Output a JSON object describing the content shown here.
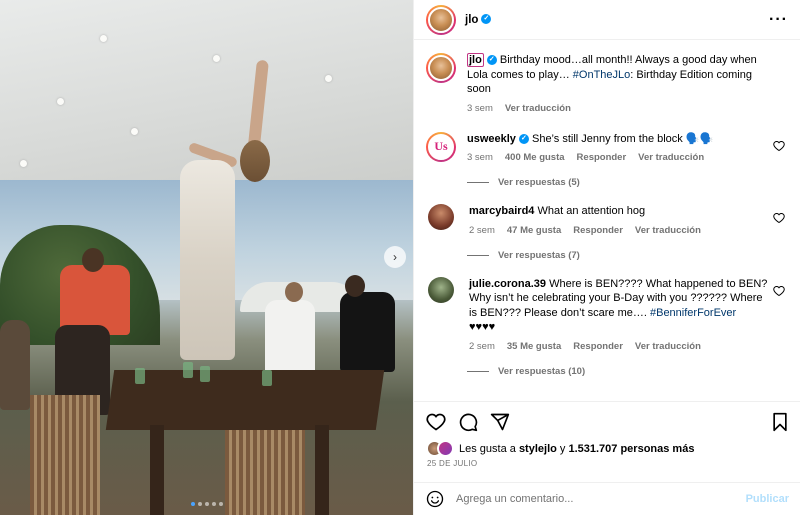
{
  "post": {
    "username": "jlo",
    "photo_alt": "Mujer bailando sobre una mesa en una fiesta de cumpleaños",
    "carousel_pages": 5,
    "carousel_active": 1
  },
  "caption": {
    "username": "jlo",
    "text_before": "Birthday mood…all month!! Always a good day when Lola comes to play… ",
    "hashtag": "#OnTheJLo",
    "text_after": ": Birthday Edition coming soon",
    "time": "3 sem",
    "translate": "Ver traducción"
  },
  "comments": [
    {
      "username": "usweekly",
      "verified": true,
      "text": "She’s still Jenny from the block 🗣️🗣️",
      "time": "3 sem",
      "likes": "400 Me gusta",
      "reply": "Responder",
      "translate": "Ver traducción",
      "replies": "Ver respuestas (5)"
    },
    {
      "username": "marcybaird4",
      "verified": false,
      "text": "What an attention hog",
      "time": "2 sem",
      "likes": "47 Me gusta",
      "reply": "Responder",
      "translate": "Ver traducción",
      "replies": "Ver respuestas (7)"
    },
    {
      "username": "julie.corona.39",
      "verified": false,
      "text": "Where is BEN???? What happened to BEN? Why isn’t he celebrating your B-Day with you ?????? Where is BEN??? Please don’t scare me…. ",
      "hashtag": "#BenniferForEver",
      "text_after": "♥♥♥♥",
      "time": "2 sem",
      "likes": "35 Me gusta",
      "reply": "Responder",
      "translate": "Ver traducción",
      "replies": "Ver respuestas (10)"
    }
  ],
  "likes": {
    "prefix": "Les gusta a ",
    "user": "stylejlo",
    "middle": " y ",
    "count": "1.531.707 personas más"
  },
  "date": "25 DE JULIO",
  "add_comment": {
    "placeholder": "Agrega un comentario...",
    "publish": "Publicar"
  },
  "colors": {
    "verified": "#0095f6",
    "link": "#00376b",
    "muted": "#737373",
    "publish_disabled": "#b2dffc"
  },
  "icons": [
    "heart-icon",
    "comment-icon",
    "share-icon",
    "bookmark-icon",
    "emoji-icon",
    "more-icon",
    "verified-icon",
    "chevron-right-icon"
  ]
}
